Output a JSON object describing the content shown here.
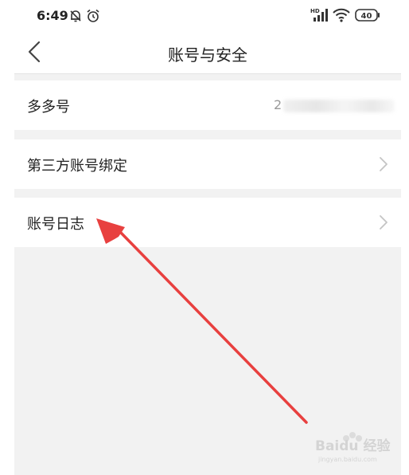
{
  "status_bar": {
    "time": "6:49",
    "battery": "40",
    "network_label": "HD"
  },
  "header": {
    "title": "账号与安全"
  },
  "rows": [
    {
      "label": "多多号",
      "value": "2"
    },
    {
      "label": "第三方账号绑定"
    },
    {
      "label": "账号日志"
    }
  ],
  "annotation": {
    "color": "#e8403f"
  },
  "watermark": {
    "text": "Baidu 经验",
    "sub": "jingyan.baidu.com"
  }
}
